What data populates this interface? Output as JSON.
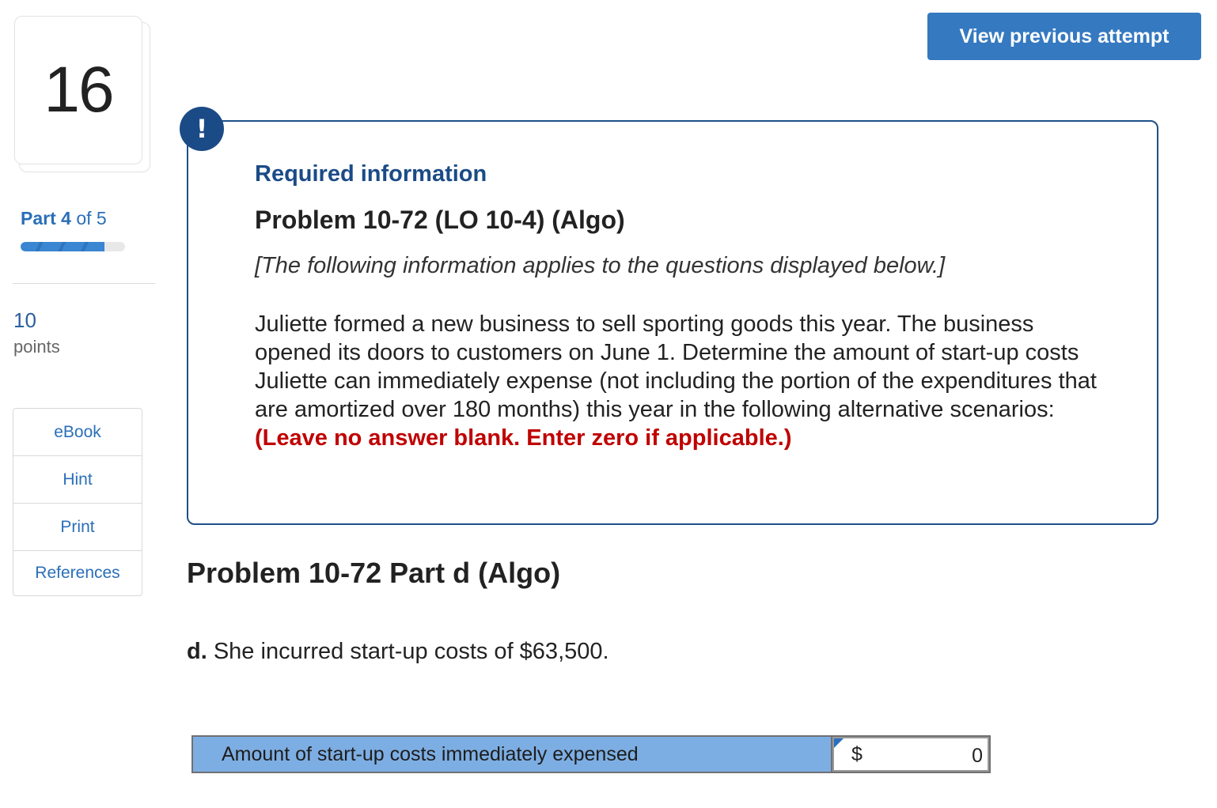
{
  "question": {
    "number": "16"
  },
  "part": {
    "prefix": "Part",
    "current": "4",
    "of_label": "of 5",
    "progress_fraction": 0.8
  },
  "points": {
    "value": "10",
    "label": "points"
  },
  "tools": [
    "eBook",
    "Hint",
    "Print",
    "References"
  ],
  "header": {
    "view_previous_label": "View previous attempt"
  },
  "info": {
    "alert_glyph": "!",
    "required_label": "Required information",
    "problem_title": "Problem 10-72 (LO 10-4) (Algo)",
    "following_text": "[The following information applies to the questions displayed below.]",
    "body_text": "Juliette formed a new business to sell sporting goods this year. The business opened its doors to customers on June 1. Determine the amount of start-up costs Juliette can immediately expense (not including the portion of the expenditures that are amortized over 180 months) this year in the following alternative scenarios: ",
    "warning_text": "(Leave no answer blank. Enter zero if applicable.)"
  },
  "part_d": {
    "title": "Problem 10-72 Part d (Algo)",
    "letter": "d.",
    "question": " She incurred start-up costs of $63,500."
  },
  "answer": {
    "label": "Amount of start-up costs immediately expensed",
    "currency": "$",
    "value": "0"
  },
  "colors": {
    "accent": "#3579c0",
    "navy": "#1b4b87",
    "warning": "#c00000",
    "answer_label_bg": "#7daee3"
  }
}
